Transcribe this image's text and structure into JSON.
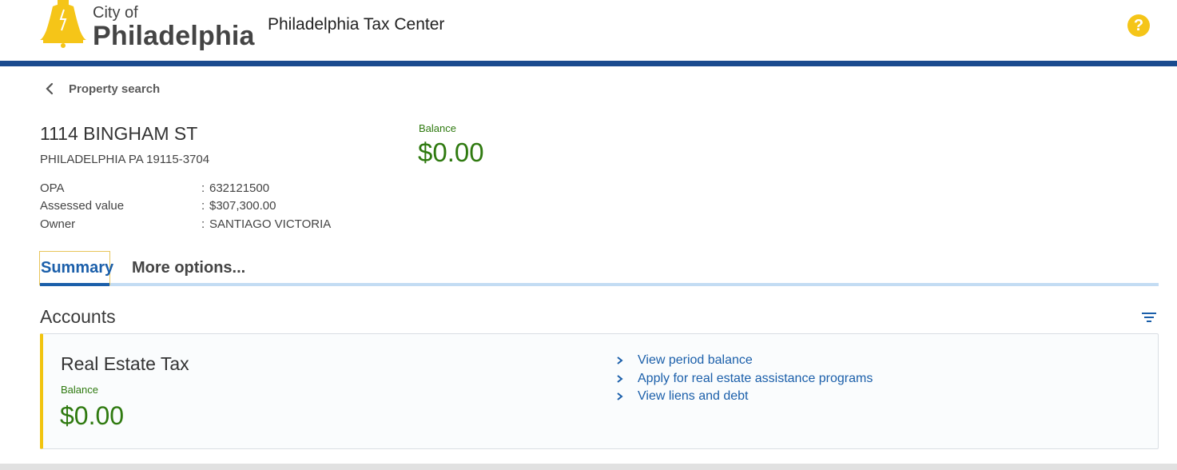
{
  "header": {
    "logo_city": "City of",
    "logo_name": "Philadelphia",
    "app_title": "Philadelphia Tax Center",
    "help_symbol": "?",
    "accent_color": "#1b4b8f",
    "logo_color": "#f5c518"
  },
  "breadcrumb": {
    "back_label": "Property search"
  },
  "property": {
    "address": "1114 BINGHAM ST",
    "city_line": "PHILADELPHIA PA 19115-3704",
    "details": [
      {
        "key": "OPA",
        "sep": ":",
        "value": "632121500"
      },
      {
        "key": "Assessed value",
        "sep": ":",
        "value": "$307,300.00"
      },
      {
        "key": "Owner",
        "sep": ":",
        "value": "SANTIAGO VICTORIA"
      }
    ],
    "balance_label": "Balance",
    "balance_value": "$0.00",
    "balance_color": "#2f7a10"
  },
  "tabs": {
    "items": [
      {
        "label": "Summary",
        "active": true
      },
      {
        "label": "More options..."
      }
    ]
  },
  "accounts": {
    "title": "Accounts",
    "cards": [
      {
        "title": "Real Estate Tax",
        "balance_label": "Balance",
        "balance_value": "$0.00",
        "links": [
          {
            "label": "View period balance"
          },
          {
            "label": "Apply for real estate assistance programs"
          },
          {
            "label": "View liens and debt"
          }
        ]
      }
    ]
  }
}
